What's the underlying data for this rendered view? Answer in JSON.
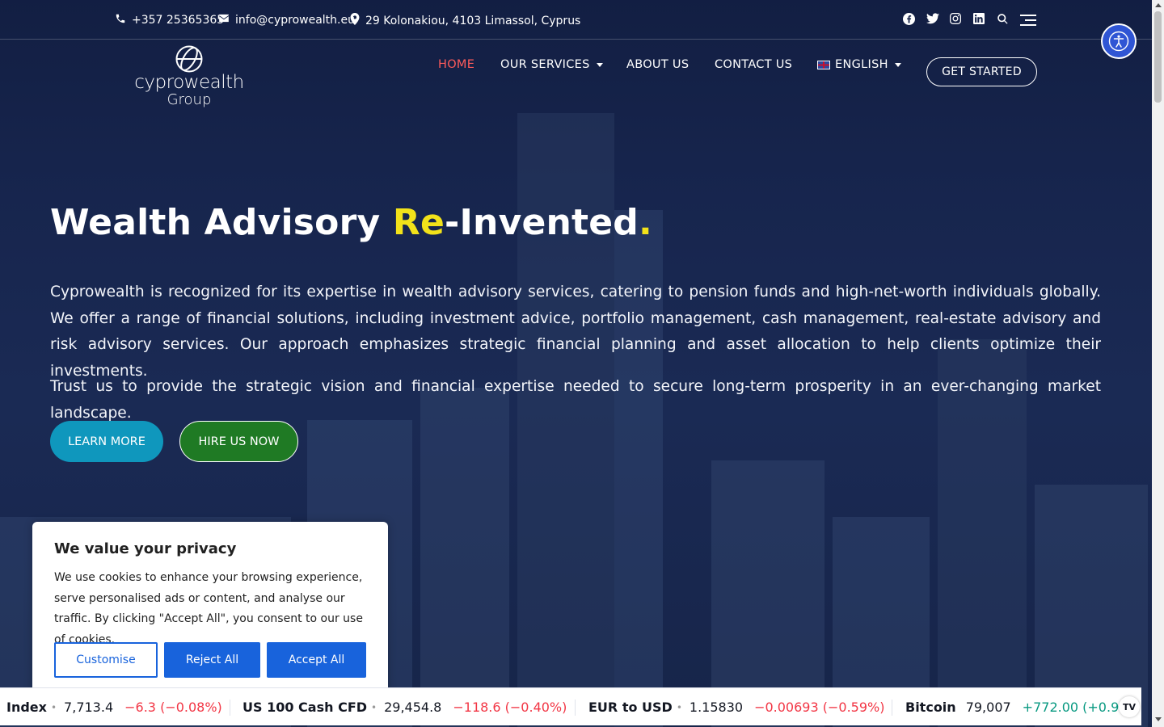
{
  "topbar": {
    "phone": "+357 25365365",
    "email": "info@cyprowealth.eu",
    "address": "29 Kolonakiou, 4103 Limassol, Cyprus",
    "socials": [
      "facebook-icon",
      "twitter-icon",
      "instagram-icon",
      "linkedin-icon",
      "search-icon"
    ]
  },
  "logo": {
    "line1": "cyprowealth",
    "line2": "Group"
  },
  "nav": {
    "home": "HOME",
    "services": "OUR SERVICES",
    "about": "ABOUT US",
    "contact": "CONTACT US",
    "language": "ENGLISH",
    "cta": "GET STARTED"
  },
  "hero": {
    "headline_part1": "Wealth Advisory ",
    "headline_highlight": "Re",
    "headline_part2": "-Invented",
    "headline_dot": ".",
    "paragraph1": "Cyprowealth is recognized for its expertise in wealth advisory services, catering to pension funds and high-net-worth individuals globally. We offer a range of financial solutions, including investment advice, portfolio management, cash management, real-estate advisory and risk advisory services. Our approach emphasizes strategic financial planning and asset allocation to help clients optimize their investments.",
    "paragraph2": "Trust us to provide the strategic vision and financial expertise needed to secure long-term prosperity in an ever-changing market landscape.",
    "learn_more": "LEARN MORE",
    "hire_us": "HIRE US NOW"
  },
  "cookie": {
    "title": "We value your privacy",
    "text": "We use cookies to enhance your browsing experience, serve personalised ads or content, and analyse our traffic. By clicking \"Accept All\", you consent to our use of cookies.",
    "customise": "Customise",
    "reject": "Reject All",
    "accept": "Accept All"
  },
  "ticker": [
    {
      "name": "Index",
      "value": "7,713.4",
      "change": "−6.3 (−0.08%)",
      "direction": "down"
    },
    {
      "name": "US 100 Cash CFD",
      "value": "29,454.8",
      "change": "−118.6 (−0.40%)",
      "direction": "down"
    },
    {
      "name": "EUR to USD",
      "value": "1.15830",
      "change": "−0.00693 (−0.59%)",
      "direction": "down"
    },
    {
      "name": "Bitcoin",
      "value": "79,007",
      "change": "+772.00 (+0.9",
      "direction": "up"
    }
  ],
  "ticker_logo": "TV",
  "colors": {
    "accent_red": "#ff5b5b",
    "highlight_yellow": "#f2e21a",
    "learn_btn": "#0f97bd",
    "hire_btn": "#1f7a24",
    "cookie_blue": "#1863dc"
  }
}
